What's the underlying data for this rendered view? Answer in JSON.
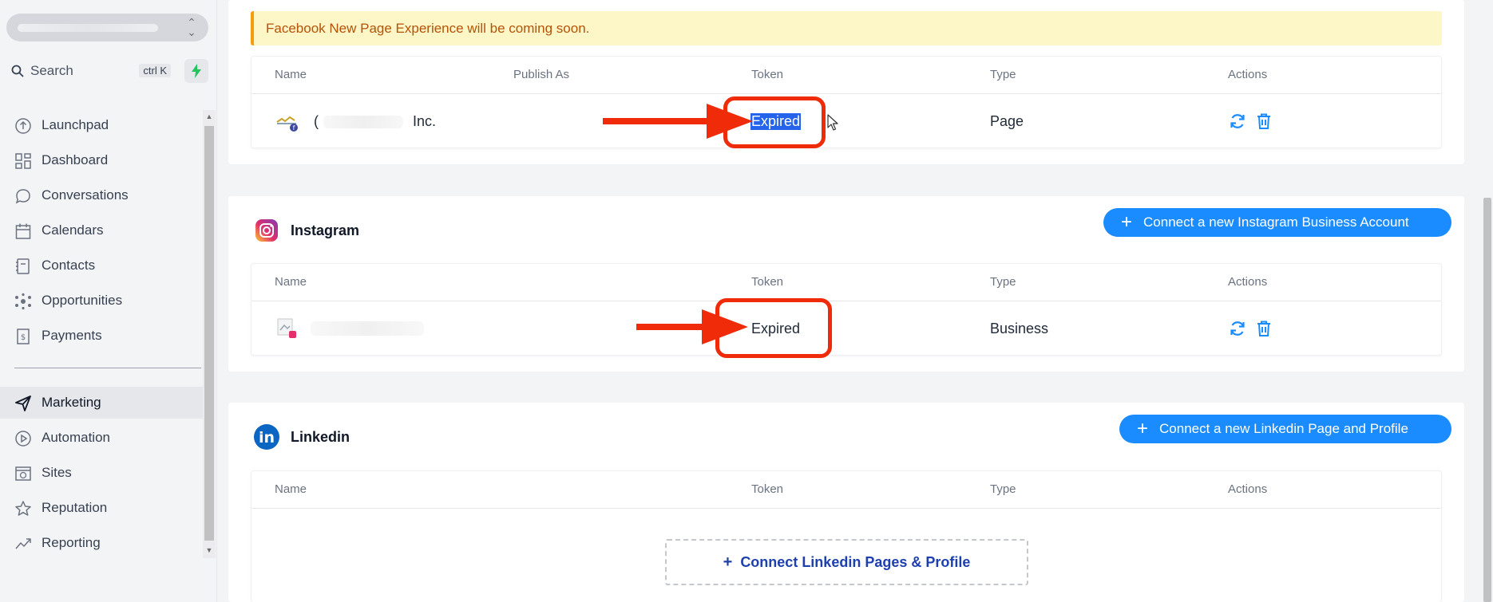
{
  "sidebar": {
    "search_label": "Search",
    "search_shortcut": "ctrl K",
    "nav": [
      {
        "label": "Launchpad",
        "icon": "launchpad-icon"
      },
      {
        "label": "Dashboard",
        "icon": "dashboard-icon"
      },
      {
        "label": "Conversations",
        "icon": "chat-bubble-icon"
      },
      {
        "label": "Calendars",
        "icon": "calendar-icon"
      },
      {
        "label": "Contacts",
        "icon": "contacts-icon"
      },
      {
        "label": "Opportunities",
        "icon": "opportunities-icon"
      },
      {
        "label": "Payments",
        "icon": "payments-icon"
      },
      {
        "label": "Marketing",
        "icon": "send-icon",
        "active": true
      },
      {
        "label": "Automation",
        "icon": "automation-icon"
      },
      {
        "label": "Sites",
        "icon": "sites-icon"
      },
      {
        "label": "Reputation",
        "icon": "star-icon"
      },
      {
        "label": "Reporting",
        "icon": "trend-icon"
      }
    ]
  },
  "facebook": {
    "notice": "Facebook New Page Experience will be coming soon.",
    "headers": {
      "name": "Name",
      "publish_as": "Publish As",
      "token": "Token",
      "type": "Type",
      "actions": "Actions"
    },
    "row": {
      "name_start": "(",
      "name_end": "Inc.",
      "token": "Expired",
      "type": "Page"
    }
  },
  "instagram": {
    "title": "Instagram",
    "connect_button": "Connect a new Instagram Business Account",
    "headers": {
      "name": "Name",
      "token": "Token",
      "type": "Type",
      "actions": "Actions"
    },
    "row": {
      "token": "Expired",
      "type": "Business"
    }
  },
  "linkedin": {
    "title": "Linkedin",
    "connect_button": "Connect a new Linkedin Page and Profile",
    "headers": {
      "name": "Name",
      "token": "Token",
      "type": "Type",
      "actions": "Actions"
    },
    "empty_action": "Connect Linkedin Pages & Profile"
  },
  "colors": {
    "primary": "#1a8cff",
    "annotation_red": "#ef2b0a",
    "notice_bg": "#fdf6c6",
    "notice_text": "#b45309"
  }
}
